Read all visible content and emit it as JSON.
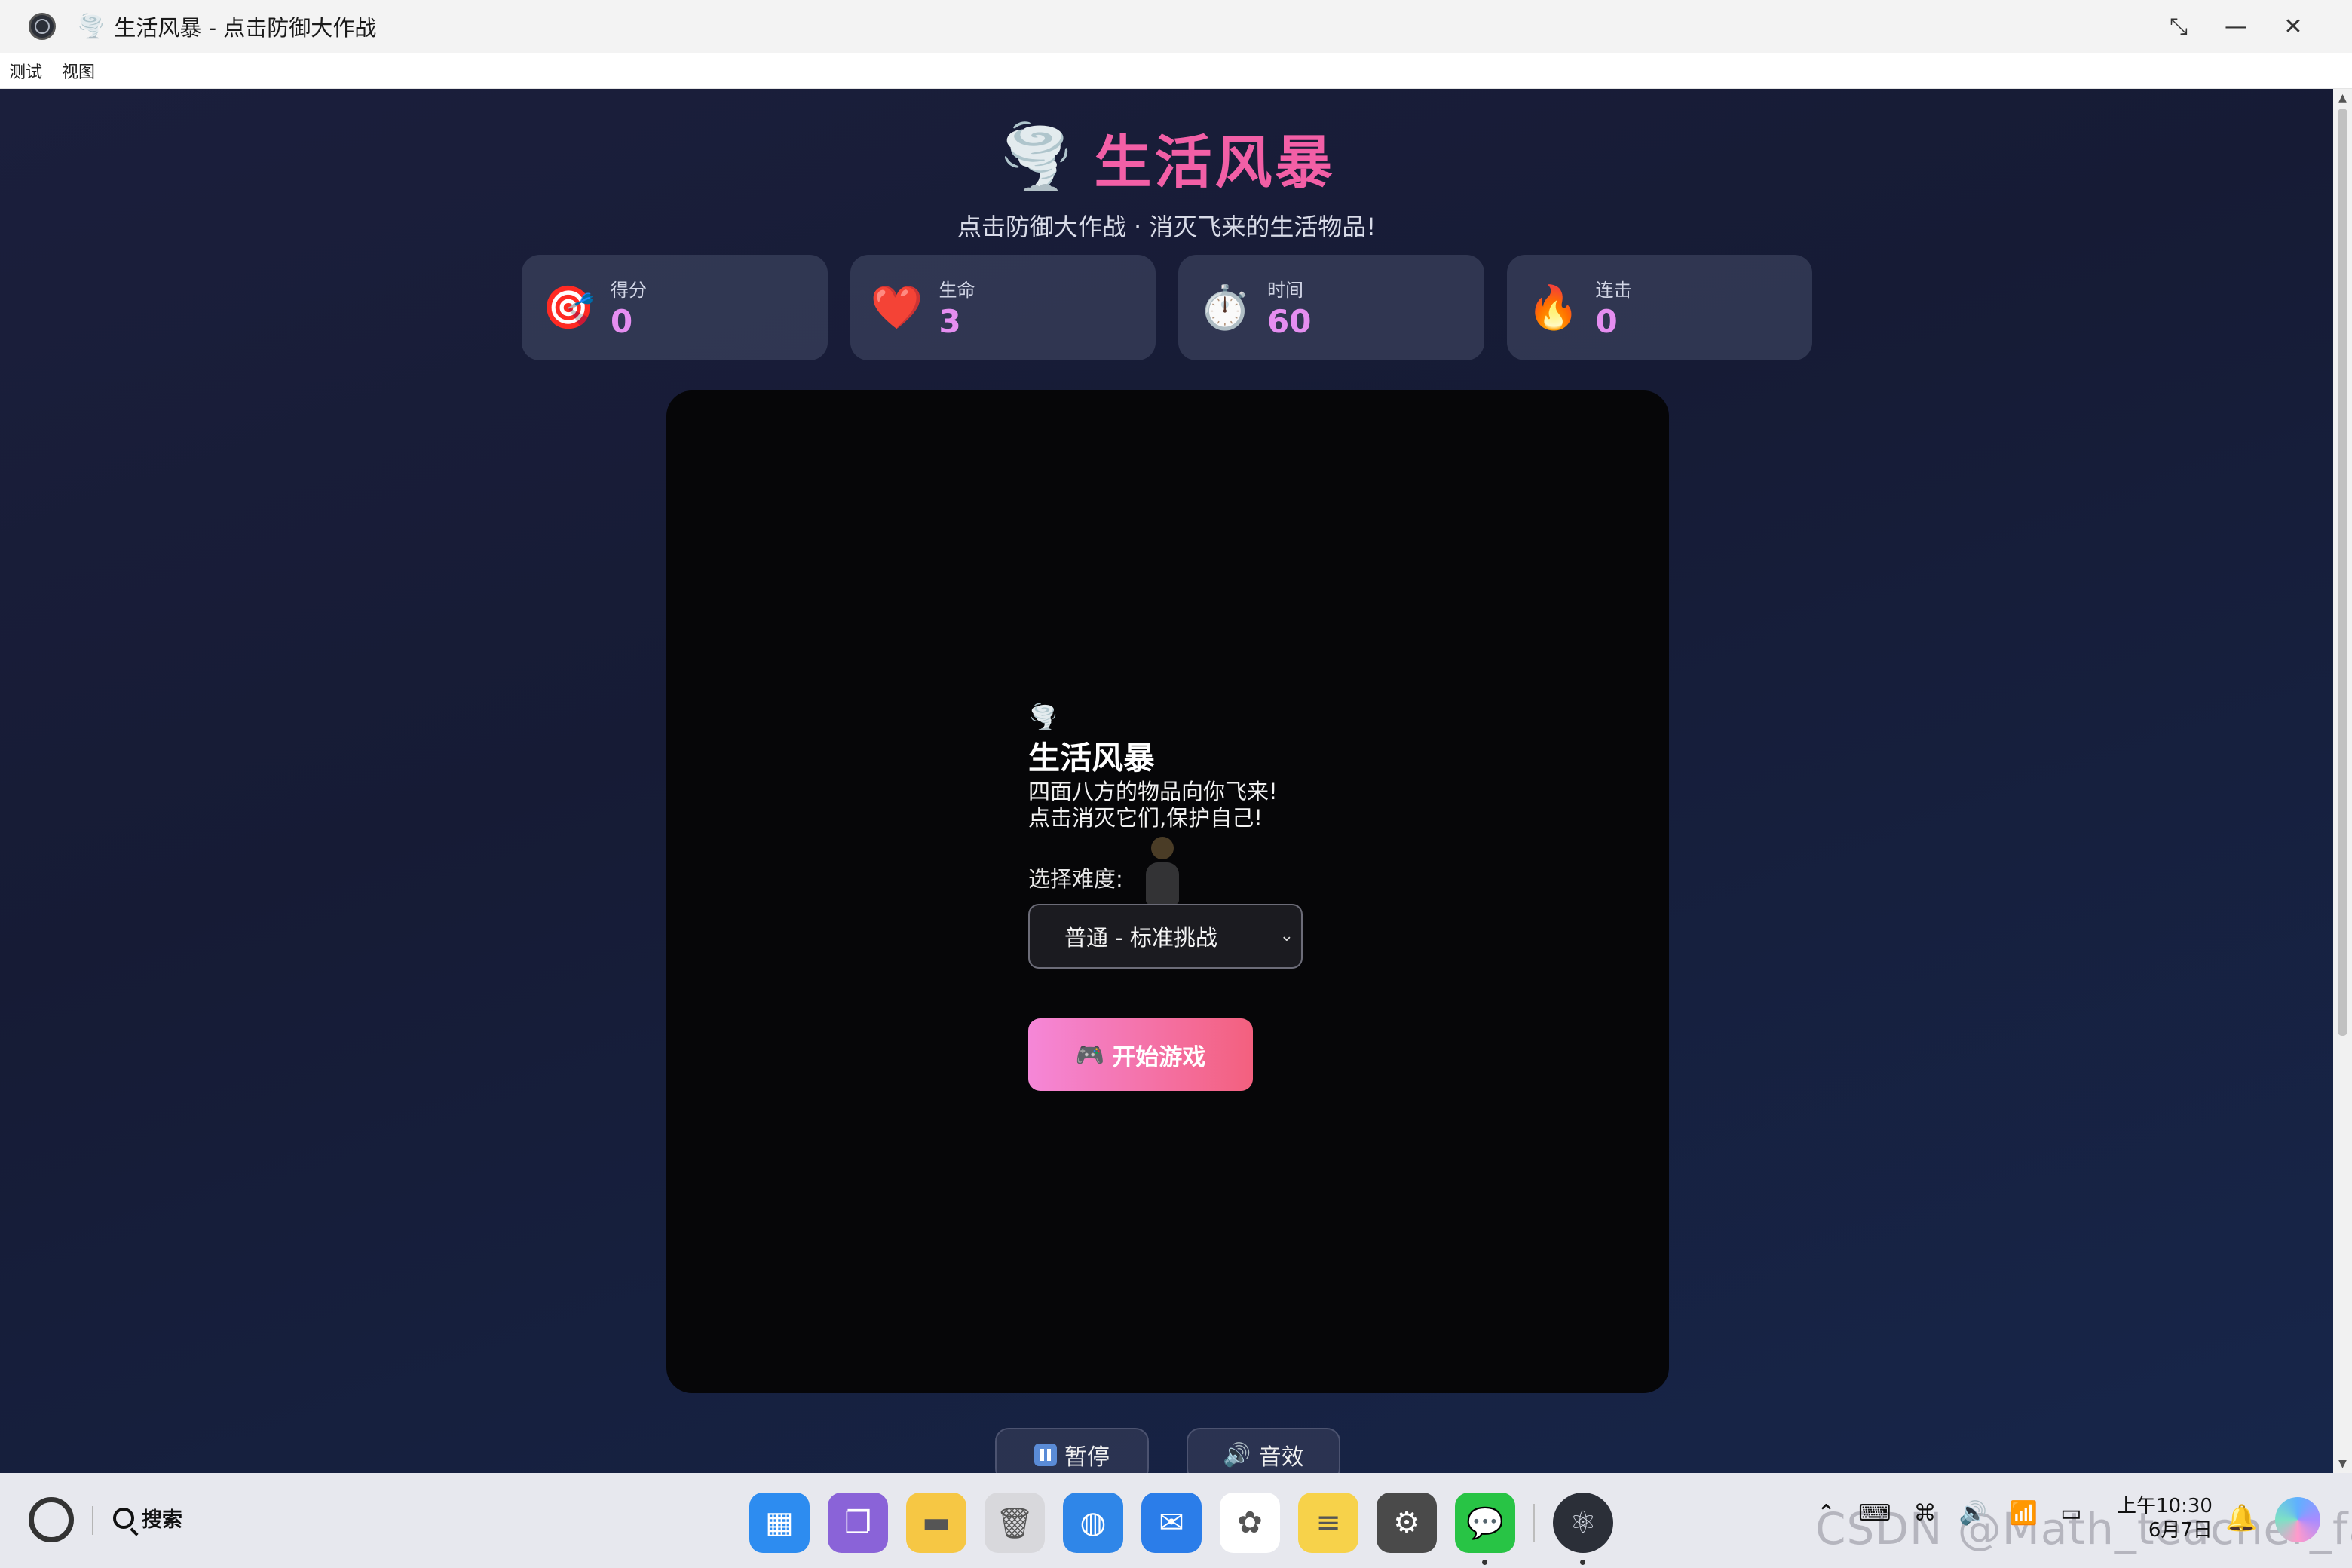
{
  "window": {
    "title": "生活风暴 - 点击防御大作战",
    "title_icon": "🌪️",
    "controls": [
      "restore-icon",
      "minimize-icon",
      "close-icon"
    ]
  },
  "menu": {
    "items": [
      "测试",
      "视图"
    ]
  },
  "header": {
    "icon": "🌪️",
    "title": "生活风暴",
    "subtitle": "点击防御大作战 · 消灭飞来的生活物品!"
  },
  "stats": [
    {
      "icon": "🎯",
      "label": "得分",
      "value": "0"
    },
    {
      "icon": "❤️",
      "label": "生命",
      "value": "3"
    },
    {
      "icon": "⏱️",
      "label": "时间",
      "value": "60"
    },
    {
      "icon": "🔥",
      "label": "连击",
      "value": "0"
    }
  ],
  "overlay": {
    "icon": "🌪️",
    "title": "生活风暴",
    "desc_line1": "四面八方的物品向你飞来!",
    "desc_line2": "点击消灭它们,保护自己!",
    "difficulty_label": "选择难度:",
    "difficulty_selected": "普通 - 标准挑战",
    "start_icon": "🎮",
    "start_label": "开始游戏"
  },
  "controls": {
    "pause_label": "暂停",
    "sound_icon": "🔊",
    "sound_label": "音效"
  },
  "taskbar": {
    "search_label": "搜索",
    "apps": [
      {
        "name": "launcher",
        "glyph": "▦",
        "bg": "#2d8cf0"
      },
      {
        "name": "multitask",
        "glyph": "❐",
        "bg": "#8a63d8"
      },
      {
        "name": "files",
        "glyph": "▬",
        "bg": "#f6c744"
      },
      {
        "name": "trash",
        "glyph": "🗑",
        "bg": "#d8d8dc"
      },
      {
        "name": "browser",
        "glyph": "◍",
        "bg": "#2f86e8"
      },
      {
        "name": "mail",
        "glyph": "✉",
        "bg": "#2b7de9"
      },
      {
        "name": "photos",
        "glyph": "✿",
        "bg": "#ffffff"
      },
      {
        "name": "notes",
        "glyph": "≡",
        "bg": "#f7d24a"
      },
      {
        "name": "settings",
        "glyph": "⚙",
        "bg": "#4a4a4a"
      },
      {
        "name": "wechat",
        "glyph": "💬",
        "bg": "#28c445"
      }
    ],
    "clock_time": "上午10:30",
    "clock_date": "6月7日",
    "tray_icons": [
      "chevron-up-icon",
      "input-method-icon",
      "keyboard-icon",
      "volume-icon",
      "wifi-icon",
      "battery-icon"
    ],
    "watermark": "CSDN @Math_teacher_fan"
  }
}
